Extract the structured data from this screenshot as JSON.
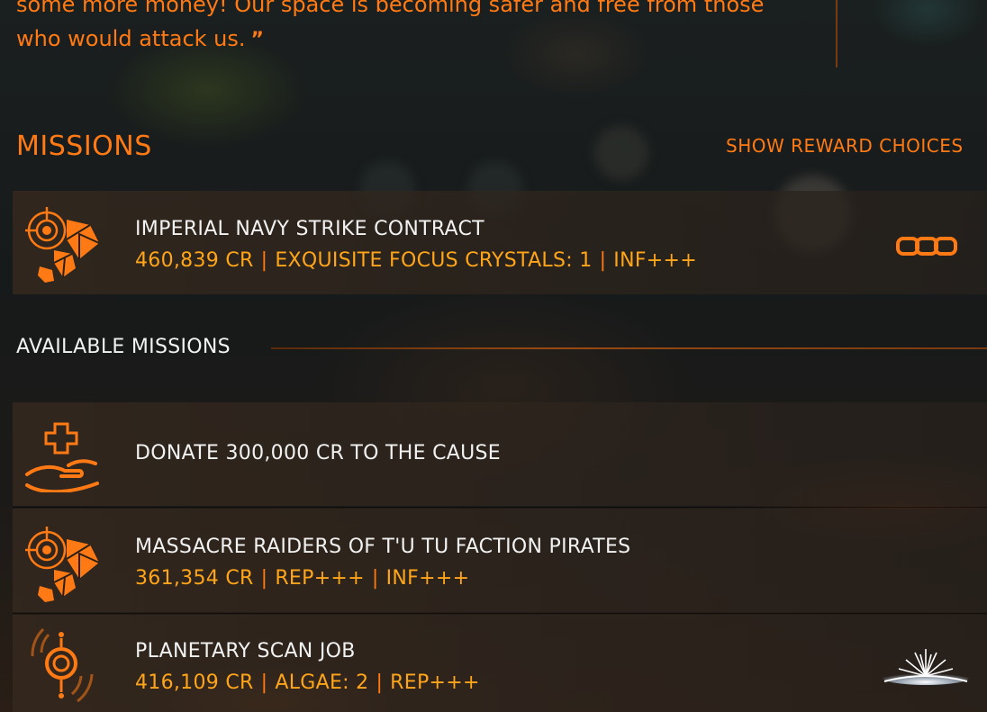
{
  "quote": {
    "line1": "some more money! Our space is becoming safer and free from those",
    "line2": "who would attack us."
  },
  "missions_header": "MISSIONS",
  "show_reward_choices": "SHOW REWARD CHOICES",
  "active_mission": {
    "title": "IMPERIAL NAVY STRIKE CONTRACT",
    "rewards": [
      "460,839 CR",
      "EXQUISITE FOCUS CRYSTALS: 1",
      "INF+++"
    ],
    "icon": "combat-crosshair-crystal-icon",
    "status_icon": "linked-chain-icon"
  },
  "available_label": "AVAILABLE MISSIONS",
  "available_missions": [
    {
      "title": "DONATE 300,000 CR TO THE CAUSE",
      "rewards": [],
      "icon": "donation-hand-plus-icon"
    },
    {
      "title": "MASSACRE RAIDERS OF T'U TU FACTION PIRATES",
      "rewards": [
        "361,354 CR",
        "REP+++",
        "INF+++"
      ],
      "icon": "combat-crosshair-crystal-icon"
    },
    {
      "title": "PLANETARY SCAN JOB",
      "rewards": [
        "416,109 CR",
        "ALGAE: 2",
        "REP+++"
      ],
      "icon": "scan-signal-icon",
      "extra_icon": "planet-horizon-sunrise-icon"
    }
  ],
  "colors": {
    "accent": "#ff7a14",
    "reward": "#ffa51a",
    "title": "#f2f2f2"
  }
}
